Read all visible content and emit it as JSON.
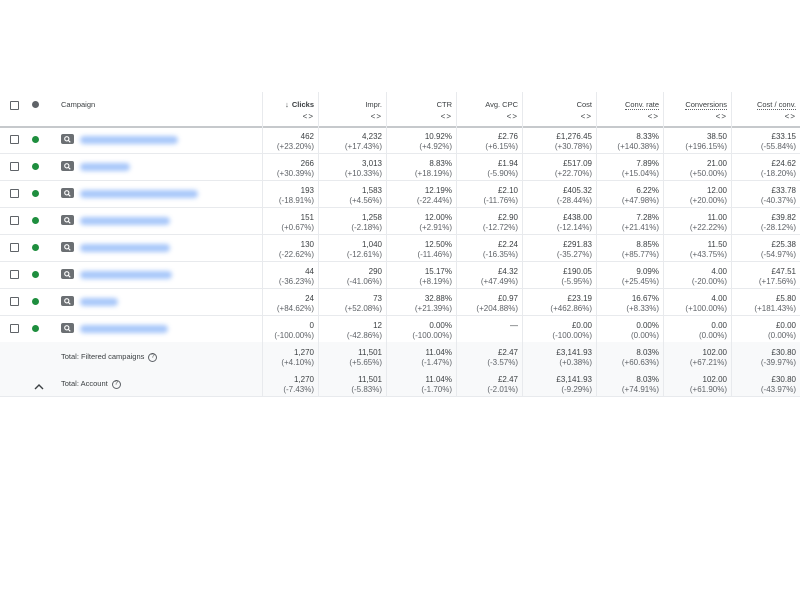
{
  "header": {
    "campaign": "Campaign",
    "columns": [
      {
        "key": "clicks",
        "label": "Clicks",
        "sorted": true,
        "sort_glyph": "↓",
        "toggle": "<>"
      },
      {
        "key": "impr",
        "label": "Impr.",
        "toggle": "<>"
      },
      {
        "key": "ctr",
        "label": "CTR",
        "toggle": "<>"
      },
      {
        "key": "cpc",
        "label": "Avg. CPC",
        "toggle": "<>"
      },
      {
        "key": "cost",
        "label": "Cost",
        "toggle": "<>"
      },
      {
        "key": "convrate",
        "label": "Conv. rate",
        "dotted": true,
        "toggle": "<>"
      },
      {
        "key": "conv",
        "label": "Conversions",
        "dotted": true,
        "toggle": "<>"
      },
      {
        "key": "costconv",
        "label": "Cost / conv.",
        "dotted": true,
        "toggle": "<>"
      }
    ]
  },
  "rows": [
    {
      "status": "enabled",
      "type": "search-icon",
      "clicks": [
        "462",
        "(+23.20%)"
      ],
      "impr": [
        "4,232",
        "(+17.43%)"
      ],
      "ctr": [
        "10.92%",
        "(+4.92%)"
      ],
      "cpc": [
        "£2.76",
        "(+6.15%)"
      ],
      "cost": [
        "£1,276.45",
        "(+30.78%)"
      ],
      "convrate": [
        "8.33%",
        "(+140.38%)"
      ],
      "conv": [
        "38.50",
        "(+196.15%)"
      ],
      "costconv": [
        "£33.15",
        "(-55.84%)"
      ]
    },
    {
      "status": "enabled",
      "type": "search-icon",
      "clicks": [
        "266",
        "(+30.39%)"
      ],
      "impr": [
        "3,013",
        "(+10.33%)"
      ],
      "ctr": [
        "8.83%",
        "(+18.19%)"
      ],
      "cpc": [
        "£1.94",
        "(-5.90%)"
      ],
      "cost": [
        "£517.09",
        "(+22.70%)"
      ],
      "convrate": [
        "7.89%",
        "(+15.04%)"
      ],
      "conv": [
        "21.00",
        "(+50.00%)"
      ],
      "costconv": [
        "£24.62",
        "(-18.20%)"
      ]
    },
    {
      "status": "enabled",
      "type": "search-icon",
      "clicks": [
        "193",
        "(-18.91%)"
      ],
      "impr": [
        "1,583",
        "(+4.56%)"
      ],
      "ctr": [
        "12.19%",
        "(-22.44%)"
      ],
      "cpc": [
        "£2.10",
        "(-11.76%)"
      ],
      "cost": [
        "£405.32",
        "(-28.44%)"
      ],
      "convrate": [
        "6.22%",
        "(+47.98%)"
      ],
      "conv": [
        "12.00",
        "(+20.00%)"
      ],
      "costconv": [
        "£33.78",
        "(-40.37%)"
      ]
    },
    {
      "status": "enabled",
      "type": "search-icon",
      "clicks": [
        "151",
        "(+0.67%)"
      ],
      "impr": [
        "1,258",
        "(-2.18%)"
      ],
      "ctr": [
        "12.00%",
        "(+2.91%)"
      ],
      "cpc": [
        "£2.90",
        "(-12.72%)"
      ],
      "cost": [
        "£438.00",
        "(-12.14%)"
      ],
      "convrate": [
        "7.28%",
        "(+21.41%)"
      ],
      "conv": [
        "11.00",
        "(+22.22%)"
      ],
      "costconv": [
        "£39.82",
        "(-28.12%)"
      ]
    },
    {
      "status": "enabled",
      "type": "search-icon",
      "clicks": [
        "130",
        "(-22.62%)"
      ],
      "impr": [
        "1,040",
        "(-12.61%)"
      ],
      "ctr": [
        "12.50%",
        "(-11.46%)"
      ],
      "cpc": [
        "£2.24",
        "(-16.35%)"
      ],
      "cost": [
        "£291.83",
        "(-35.27%)"
      ],
      "convrate": [
        "8.85%",
        "(+85.77%)"
      ],
      "conv": [
        "11.50",
        "(+43.75%)"
      ],
      "costconv": [
        "£25.38",
        "(-54.97%)"
      ]
    },
    {
      "status": "enabled",
      "type": "search-icon",
      "clicks": [
        "44",
        "(-36.23%)"
      ],
      "impr": [
        "290",
        "(-41.06%)"
      ],
      "ctr": [
        "15.17%",
        "(+8.19%)"
      ],
      "cpc": [
        "£4.32",
        "(+47.49%)"
      ],
      "cost": [
        "£190.05",
        "(-5.95%)"
      ],
      "convrate": [
        "9.09%",
        "(+25.45%)"
      ],
      "conv": [
        "4.00",
        "(-20.00%)"
      ],
      "costconv": [
        "£47.51",
        "(+17.56%)"
      ]
    },
    {
      "status": "enabled",
      "type": "search-icon",
      "clicks": [
        "24",
        "(+84.62%)"
      ],
      "impr": [
        "73",
        "(+52.08%)"
      ],
      "ctr": [
        "32.88%",
        "(+21.39%)"
      ],
      "cpc": [
        "£0.97",
        "(+204.88%)"
      ],
      "cost": [
        "£23.19",
        "(+462.86%)"
      ],
      "convrate": [
        "16.67%",
        "(+8.33%)"
      ],
      "conv": [
        "4.00",
        "(+100.00%)"
      ],
      "costconv": [
        "£5.80",
        "(+181.43%)"
      ]
    },
    {
      "status": "enabled",
      "type": "search-icon",
      "clicks": [
        "0",
        "(-100.00%)"
      ],
      "impr": [
        "12",
        "(-42.86%)"
      ],
      "ctr": [
        "0.00%",
        "(-100.00%)"
      ],
      "cpc": [
        "—",
        ""
      ],
      "cost": [
        "£0.00",
        "(-100.00%)"
      ],
      "convrate": [
        "0.00%",
        "(0.00%)"
      ],
      "conv": [
        "0.00",
        "(0.00%)"
      ],
      "costconv": [
        "£0.00",
        "(0.00%)"
      ]
    }
  ],
  "totals": [
    {
      "label": "Total: Filtered campaigns",
      "clicks": [
        "1,270",
        "(+4.10%)"
      ],
      "impr": [
        "11,501",
        "(+5.65%)"
      ],
      "ctr": [
        "11.04%",
        "(-1.47%)"
      ],
      "cpc": [
        "£2.47",
        "(-3.57%)"
      ],
      "cost": [
        "£3,141.93",
        "(+0.38%)"
      ],
      "convrate": [
        "8.03%",
        "(+60.63%)"
      ],
      "conv": [
        "102.00",
        "(+67.21%)"
      ],
      "costconv": [
        "£30.80",
        "(-39.97%)"
      ]
    },
    {
      "label": "Total: Account",
      "clicks": [
        "1,270",
        "(-7.43%)"
      ],
      "impr": [
        "11,501",
        "(-5.83%)"
      ],
      "ctr": [
        "11.04%",
        "(-1.70%)"
      ],
      "cpc": [
        "£2.47",
        "(-2.01%)"
      ],
      "cost": [
        "£3,141.93",
        "(-9.29%)"
      ],
      "convrate": [
        "8.03%",
        "(+74.91%)"
      ],
      "conv": [
        "102.00",
        "(+61.90%)"
      ],
      "costconv": [
        "£30.80",
        "(-43.97%)"
      ]
    }
  ],
  "colors": {
    "enabled_dot": "#1e8e3e",
    "header_dot": "#5f6368",
    "link_blur": "#8ab4f8"
  }
}
